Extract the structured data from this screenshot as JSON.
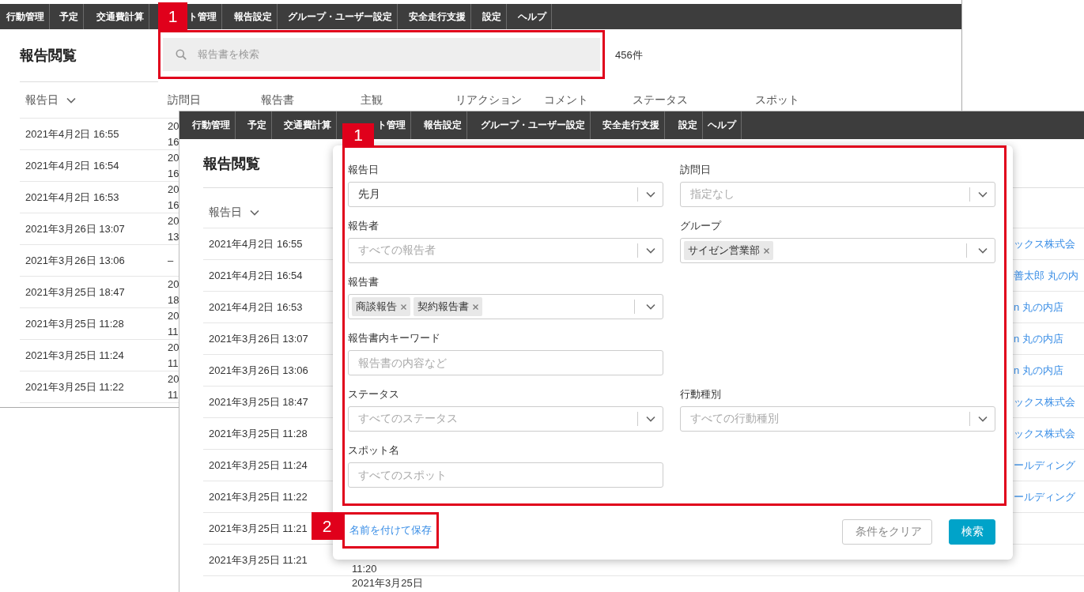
{
  "back_window": {
    "nav": [
      {
        "label": "行動管理"
      },
      {
        "label": "予定"
      },
      {
        "label": "交通費計算"
      },
      {
        "label": "ト管理"
      },
      {
        "label": "報告設定"
      },
      {
        "label": "グループ・ユーザー設定"
      },
      {
        "label": "安全走行支援"
      },
      {
        "label": "設定"
      },
      {
        "label": "ヘルプ"
      }
    ],
    "title": "報告閲覧",
    "search": {
      "placeholder": "報告書を検索",
      "badge": "1"
    },
    "count": "456件",
    "columns": [
      {
        "label": "報告日",
        "sorted": true
      },
      {
        "label": "訪問日",
        "sorted": false
      },
      {
        "label": "報告書",
        "sorted": false
      },
      {
        "label": "主観",
        "sorted": false
      },
      {
        "label": "リアクション",
        "sorted": false
      },
      {
        "label": "コメント",
        "sorted": false
      },
      {
        "label": "ステータス",
        "sorted": false
      },
      {
        "label": "スポット",
        "sorted": false
      }
    ],
    "rows": [
      {
        "report_date": "2021年4月2日 16:55",
        "visit_date": [
          "20",
          "16"
        ]
      },
      {
        "report_date": "2021年4月2日 16:54",
        "visit_date": [
          "20",
          "16"
        ]
      },
      {
        "report_date": "2021年4月2日 16:53",
        "visit_date": [
          "20",
          "16"
        ]
      },
      {
        "report_date": "2021年3月26日 13:07",
        "visit_date": [
          "20",
          "13"
        ]
      },
      {
        "report_date": "2021年3月26日 13:06",
        "visit_date": [
          "–"
        ]
      },
      {
        "report_date": "2021年3月25日 18:47",
        "visit_date": [
          "20",
          "18"
        ]
      },
      {
        "report_date": "2021年3月25日 11:28",
        "visit_date": [
          "20",
          "11"
        ]
      },
      {
        "report_date": "2021年3月25日 11:24",
        "visit_date": [
          "20",
          "11"
        ]
      },
      {
        "report_date": "2021年3月25日 11:22",
        "visit_date": [
          "20",
          "11"
        ]
      }
    ]
  },
  "front_window": {
    "nav": [
      {
        "label": "行動管理"
      },
      {
        "label": "予定"
      },
      {
        "label": "交通費計算"
      },
      {
        "label": "ト管理"
      },
      {
        "label": "報告設定"
      },
      {
        "label": "グループ・ユーザー設定"
      },
      {
        "label": "安全走行支援"
      },
      {
        "label": "設定"
      },
      {
        "label": "ヘルプ"
      }
    ],
    "title": "報告閲覧",
    "columns": [
      {
        "label": "報告日",
        "sorted": true
      }
    ],
    "rows": [
      {
        "report_date": "2021年4月2日 16:55",
        "spot": "ックス株式会"
      },
      {
        "report_date": "2021年4月2日 16:54",
        "spot": "善太郎 丸の内"
      },
      {
        "report_date": "2021年4月2日 16:53",
        "spot": "n 丸の内店"
      },
      {
        "report_date": "2021年3月26日 13:07",
        "spot": "n 丸の内店"
      },
      {
        "report_date": "2021年3月26日 13:06",
        "spot": "n 丸の内店"
      },
      {
        "report_date": "2021年3月25日 18:47",
        "spot": "ックス株式会"
      },
      {
        "report_date": "2021年3月25日 11:28",
        "spot": "ックス株式会"
      },
      {
        "report_date": "2021年3月25日 11:24",
        "spot": "ールディング"
      },
      {
        "report_date": "2021年3月25日 11:22",
        "spot": "ールディング"
      },
      {
        "report_date": "2021年3月25日 11:21"
      },
      {
        "report_date": "2021年3月25日 11:21",
        "visit_time": "11:20"
      },
      {
        "visit_date": "2021年3月25日"
      }
    ],
    "filter_panel": {
      "badge": "1",
      "field_rows": [
        [
          {
            "label": "報告日",
            "kind": "select",
            "value": "先月"
          },
          {
            "label": "訪問日",
            "kind": "select",
            "placeholder": "指定なし"
          }
        ],
        [
          {
            "label": "報告者",
            "kind": "select",
            "placeholder": "すべての報告者"
          },
          {
            "label": "グループ",
            "kind": "multiselect",
            "tags": [
              "サイゼン営業部"
            ]
          }
        ],
        [
          {
            "label": "報告書",
            "kind": "multiselect",
            "tags": [
              "商談報告",
              "契約報告書"
            ]
          }
        ],
        [
          {
            "label": "報告書内キーワード",
            "kind": "text",
            "placeholder": "報告書の内容など"
          }
        ],
        [
          {
            "label": "ステータス",
            "kind": "select",
            "placeholder": "すべてのステータス"
          },
          {
            "label": "行動種別",
            "kind": "select",
            "placeholder": "すべての行動種別"
          }
        ],
        [
          {
            "label": "スポット名",
            "kind": "text",
            "placeholder": "すべてのスポット"
          }
        ]
      ],
      "save_link": {
        "label": "名前を付けて保存",
        "badge": "2"
      },
      "buttons": [
        {
          "label": "条件をクリア",
          "kind": "secondary"
        },
        {
          "label": "検索",
          "kind": "primary"
        }
      ]
    }
  }
}
